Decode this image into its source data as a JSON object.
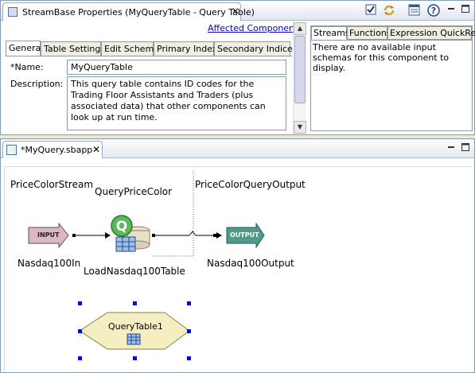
{
  "properties_view": {
    "title": "StreamBase Properties (MyQueryTable - Query Table)",
    "affected_components_link": "Affected Components",
    "tabs": [
      {
        "label": "General"
      },
      {
        "label": "Table Settings"
      },
      {
        "label": "Edit Schema"
      },
      {
        "label": "Primary Index"
      },
      {
        "label": "Secondary Indices"
      }
    ],
    "name_label": "*Name:",
    "name_value": "MyQueryTable",
    "description_label": "Description:",
    "description_value": "This query table contains ID codes for the Trading Floor Assistants and Traders (plus associated data) that other components can look up at run time.",
    "side_tabs": [
      {
        "label": "Streams"
      },
      {
        "label": "Functions"
      },
      {
        "label": "Expression QuickRef"
      }
    ],
    "side_message": "There are no available input schemas for this component to display."
  },
  "editor_view": {
    "tab_title": "*MyQuery.sbapp",
    "labels": {
      "price_color_stream": "PriceColorStream",
      "query_price_color": "QueryPriceColor",
      "price_color_query_output": "PriceColorQueryOutput",
      "input_badge": "INPUT",
      "output_badge": "OUTPUT",
      "nasdaq_in": "Nasdaq100In",
      "load_table": "LoadNasdaq100Table",
      "nasdaq_out": "Nasdaq100Output",
      "query_table": "QueryTable1"
    }
  },
  "colors": {
    "accent_blue": "#0000c8",
    "input_arrow": "#d9b8c4",
    "output_arrow": "#4f9a8a",
    "query_diamond": "#f4eec0",
    "selection_handle": "#0000ff"
  }
}
